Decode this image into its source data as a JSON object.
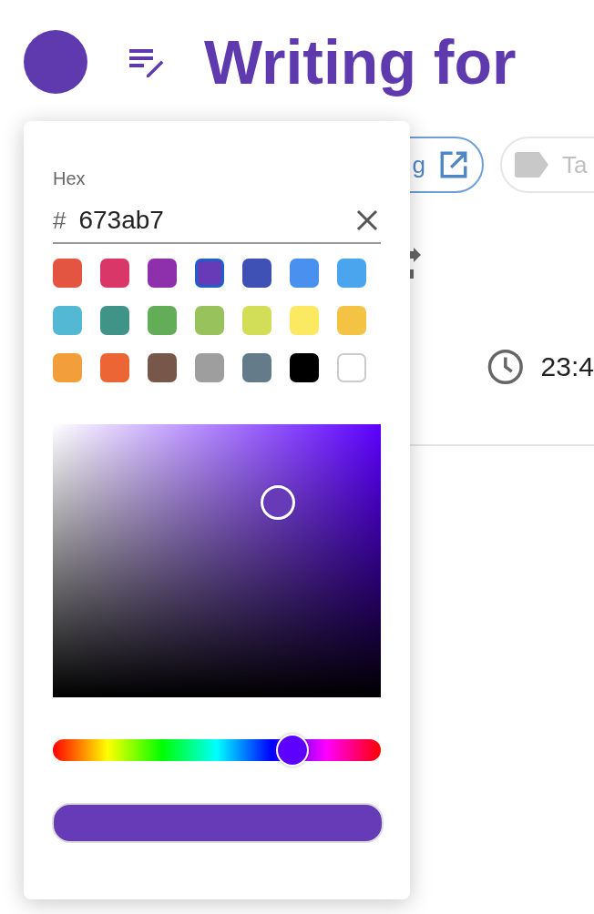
{
  "header": {
    "title": "Writing for"
  },
  "chips": [
    {
      "label": "g"
    },
    {
      "placeholder": "Ta"
    }
  ],
  "time": {
    "value": "23:4"
  },
  "picker": {
    "hex_label": "Hex",
    "prefix": "#",
    "hex": "673ab7",
    "hue": {
      "level": 0.727
    },
    "swatches": [
      {
        "color": "#e35441",
        "selected": false
      },
      {
        "color": "#d83768",
        "selected": false
      },
      {
        "color": "#8e30ac",
        "selected": false
      },
      {
        "color": "#673ab7",
        "selected": true
      },
      {
        "color": "#3f51b5",
        "selected": false
      },
      {
        "color": "#4a90ee",
        "selected": false
      },
      {
        "color": "#4aa5ee",
        "selected": false
      },
      {
        "color": "#53b8d4",
        "selected": false
      },
      {
        "color": "#409487",
        "selected": false
      },
      {
        "color": "#63ad59",
        "selected": false
      },
      {
        "color": "#98c25c",
        "selected": false
      },
      {
        "color": "#d2dd58",
        "selected": false
      },
      {
        "color": "#fbe961",
        "selected": false
      },
      {
        "color": "#f5c344",
        "selected": false
      },
      {
        "color": "#f29e3a",
        "selected": false
      },
      {
        "color": "#ec6535",
        "selected": false
      },
      {
        "color": "#775749",
        "selected": false
      },
      {
        "color": "#9e9e9e",
        "selected": false
      },
      {
        "color": "#647b89",
        "selected": false
      },
      {
        "color": "#000000",
        "selected": false
      },
      {
        "color": "#ffffff",
        "selected": false
      }
    ]
  }
}
